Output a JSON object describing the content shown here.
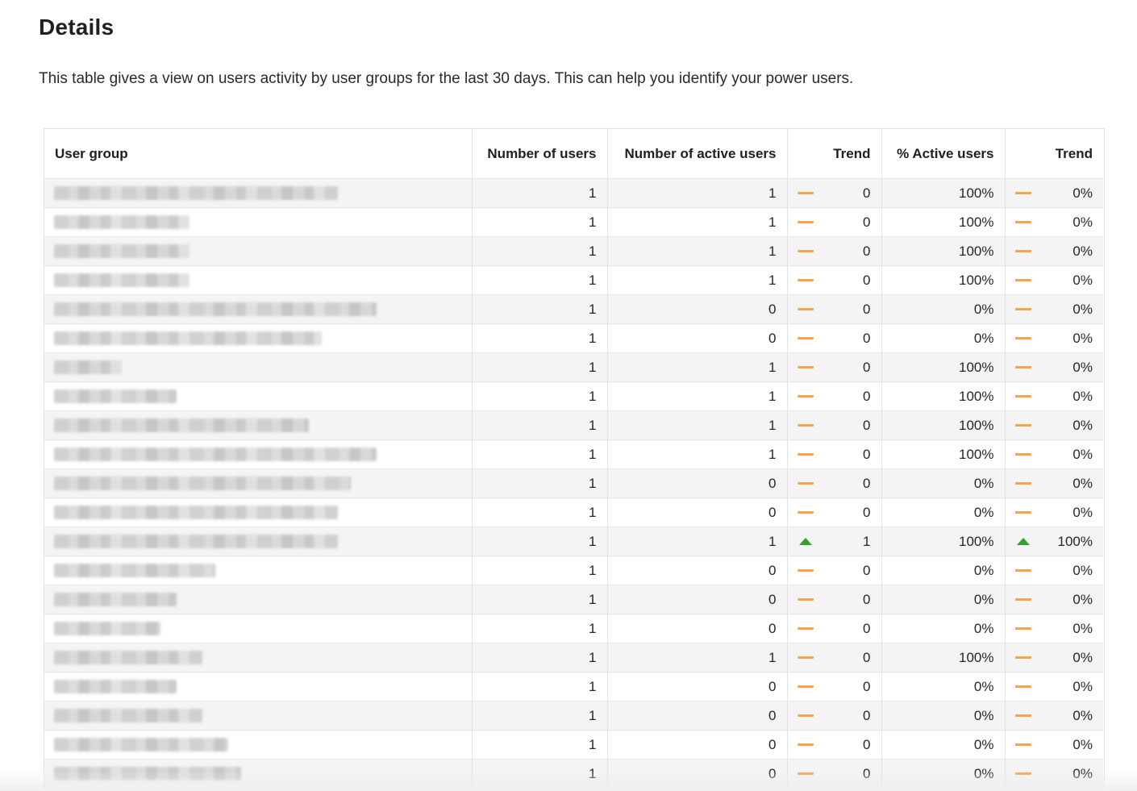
{
  "page": {
    "title": "Details",
    "description": "This table gives a view on users activity by user groups for the last 30 days. This can help you identify your power users."
  },
  "table": {
    "headers": [
      "User group",
      "Number of users",
      "Number of active users",
      "Trend",
      "% Active users",
      "Trend"
    ],
    "rows": [
      {
        "group_redacted_fraction": 0.88,
        "users": "1",
        "active": "1",
        "trend_dir": "flat",
        "trend_val": "0",
        "pct": "100%",
        "pct_trend_dir": "flat",
        "pct_trend_val": "0%"
      },
      {
        "group_redacted_fraction": 0.42,
        "users": "1",
        "active": "1",
        "trend_dir": "flat",
        "trend_val": "0",
        "pct": "100%",
        "pct_trend_dir": "flat",
        "pct_trend_val": "0%"
      },
      {
        "group_redacted_fraction": 0.42,
        "users": "1",
        "active": "1",
        "trend_dir": "flat",
        "trend_val": "0",
        "pct": "100%",
        "pct_trend_dir": "flat",
        "pct_trend_val": "0%"
      },
      {
        "group_redacted_fraction": 0.42,
        "users": "1",
        "active": "1",
        "trend_dir": "flat",
        "trend_val": "0",
        "pct": "100%",
        "pct_trend_dir": "flat",
        "pct_trend_val": "0%"
      },
      {
        "group_redacted_fraction": 1.0,
        "users": "1",
        "active": "0",
        "trend_dir": "flat",
        "trend_val": "0",
        "pct": "0%",
        "pct_trend_dir": "flat",
        "pct_trend_val": "0%"
      },
      {
        "group_redacted_fraction": 0.83,
        "users": "1",
        "active": "0",
        "trend_dir": "flat",
        "trend_val": "0",
        "pct": "0%",
        "pct_trend_dir": "flat",
        "pct_trend_val": "0%"
      },
      {
        "group_redacted_fraction": 0.21,
        "users": "1",
        "active": "1",
        "trend_dir": "flat",
        "trend_val": "0",
        "pct": "100%",
        "pct_trend_dir": "flat",
        "pct_trend_val": "0%"
      },
      {
        "group_redacted_fraction": 0.38,
        "users": "1",
        "active": "1",
        "trend_dir": "flat",
        "trend_val": "0",
        "pct": "100%",
        "pct_trend_dir": "flat",
        "pct_trend_val": "0%"
      },
      {
        "group_redacted_fraction": 0.79,
        "users": "1",
        "active": "1",
        "trend_dir": "flat",
        "trend_val": "0",
        "pct": "100%",
        "pct_trend_dir": "flat",
        "pct_trend_val": "0%"
      },
      {
        "group_redacted_fraction": 1.0,
        "users": "1",
        "active": "1",
        "trend_dir": "flat",
        "trend_val": "0",
        "pct": "100%",
        "pct_trend_dir": "flat",
        "pct_trend_val": "0%"
      },
      {
        "group_redacted_fraction": 0.92,
        "users": "1",
        "active": "0",
        "trend_dir": "flat",
        "trend_val": "0",
        "pct": "0%",
        "pct_trend_dir": "flat",
        "pct_trend_val": "0%"
      },
      {
        "group_redacted_fraction": 0.88,
        "users": "1",
        "active": "0",
        "trend_dir": "flat",
        "trend_val": "0",
        "pct": "0%",
        "pct_trend_dir": "flat",
        "pct_trend_val": "0%"
      },
      {
        "group_redacted_fraction": 0.88,
        "users": "1",
        "active": "1",
        "trend_dir": "up",
        "trend_val": "1",
        "pct": "100%",
        "pct_trend_dir": "up",
        "pct_trend_val": "100%"
      },
      {
        "group_redacted_fraction": 0.5,
        "users": "1",
        "active": "0",
        "trend_dir": "flat",
        "trend_val": "0",
        "pct": "0%",
        "pct_trend_dir": "flat",
        "pct_trend_val": "0%"
      },
      {
        "group_redacted_fraction": 0.38,
        "users": "1",
        "active": "0",
        "trend_dir": "flat",
        "trend_val": "0",
        "pct": "0%",
        "pct_trend_dir": "flat",
        "pct_trend_val": "0%"
      },
      {
        "group_redacted_fraction": 0.33,
        "users": "1",
        "active": "0",
        "trend_dir": "flat",
        "trend_val": "0",
        "pct": "0%",
        "pct_trend_dir": "flat",
        "pct_trend_val": "0%"
      },
      {
        "group_redacted_fraction": 0.46,
        "users": "1",
        "active": "1",
        "trend_dir": "flat",
        "trend_val": "0",
        "pct": "100%",
        "pct_trend_dir": "flat",
        "pct_trend_val": "0%"
      },
      {
        "group_redacted_fraction": 0.38,
        "users": "1",
        "active": "0",
        "trend_dir": "flat",
        "trend_val": "0",
        "pct": "0%",
        "pct_trend_dir": "flat",
        "pct_trend_val": "0%"
      },
      {
        "group_redacted_fraction": 0.46,
        "users": "1",
        "active": "0",
        "trend_dir": "flat",
        "trend_val": "0",
        "pct": "0%",
        "pct_trend_dir": "flat",
        "pct_trend_val": "0%"
      },
      {
        "group_redacted_fraction": 0.54,
        "users": "1",
        "active": "0",
        "trend_dir": "flat",
        "trend_val": "0",
        "pct": "0%",
        "pct_trend_dir": "flat",
        "pct_trend_val": "0%"
      },
      {
        "group_redacted_fraction": 0.58,
        "users": "1",
        "active": "0",
        "trend_dir": "flat",
        "trend_val": "0",
        "pct": "0%",
        "pct_trend_dir": "flat",
        "pct_trend_val": "0%"
      }
    ]
  },
  "colors": {
    "trend_flat": "#f5a44a",
    "trend_up": "#2ea12e",
    "row_stripe": "#f4f4f4",
    "border": "#e3e3e3"
  },
  "icons": {
    "trend_flat": "dash-icon",
    "trend_up": "triangle-up-icon"
  }
}
